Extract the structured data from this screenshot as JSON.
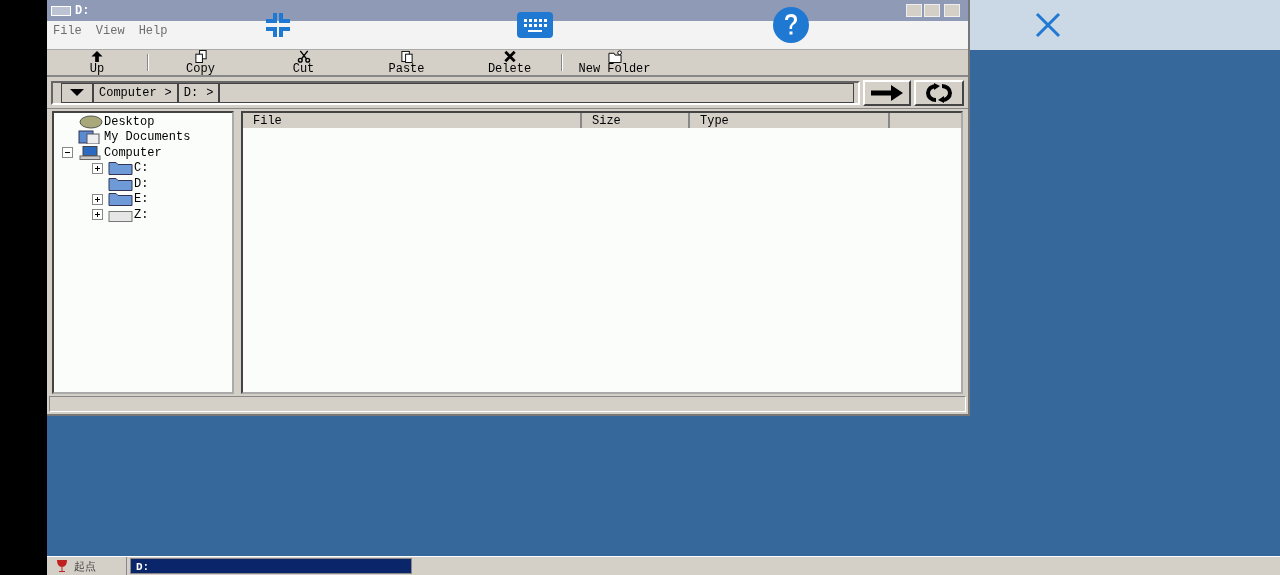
{
  "window": {
    "title": "D:",
    "menu": [
      "File",
      "View",
      "Help"
    ],
    "toolbar": [
      {
        "kind": "up",
        "label": "Up"
      },
      {
        "kind": "copy",
        "label": "Copy"
      },
      {
        "kind": "cut",
        "label": "Cut"
      },
      {
        "kind": "paste",
        "label": "Paste"
      },
      {
        "kind": "delete",
        "label": "Delete"
      },
      {
        "kind": "new_folder",
        "label": "New Folder"
      }
    ],
    "address": {
      "crumbs": [
        {
          "label": "Computer",
          "separator": ">"
        },
        {
          "label": "D:",
          "separator": ">"
        }
      ]
    },
    "tree": [
      {
        "kind": "desktop",
        "label": "Desktop",
        "expandable": false
      },
      {
        "kind": "documents",
        "label": "My Documents",
        "expandable": false
      },
      {
        "kind": "computer",
        "label": "Computer",
        "expandable": true,
        "expanded": true,
        "children": [
          {
            "kind": "folder",
            "label": "C:",
            "expandable": true,
            "expanded": false
          },
          {
            "kind": "folder",
            "label": "D:",
            "expandable": false
          },
          {
            "kind": "folder",
            "label": "E:",
            "expandable": true,
            "expanded": false
          },
          {
            "kind": "drive",
            "label": "Z:",
            "expandable": true,
            "expanded": false
          }
        ]
      }
    ],
    "columns": [
      "File",
      "Size",
      "Type"
    ]
  },
  "taskbar": {
    "start": "起点",
    "tasks": [
      {
        "label": "D:",
        "selected": true
      }
    ]
  }
}
